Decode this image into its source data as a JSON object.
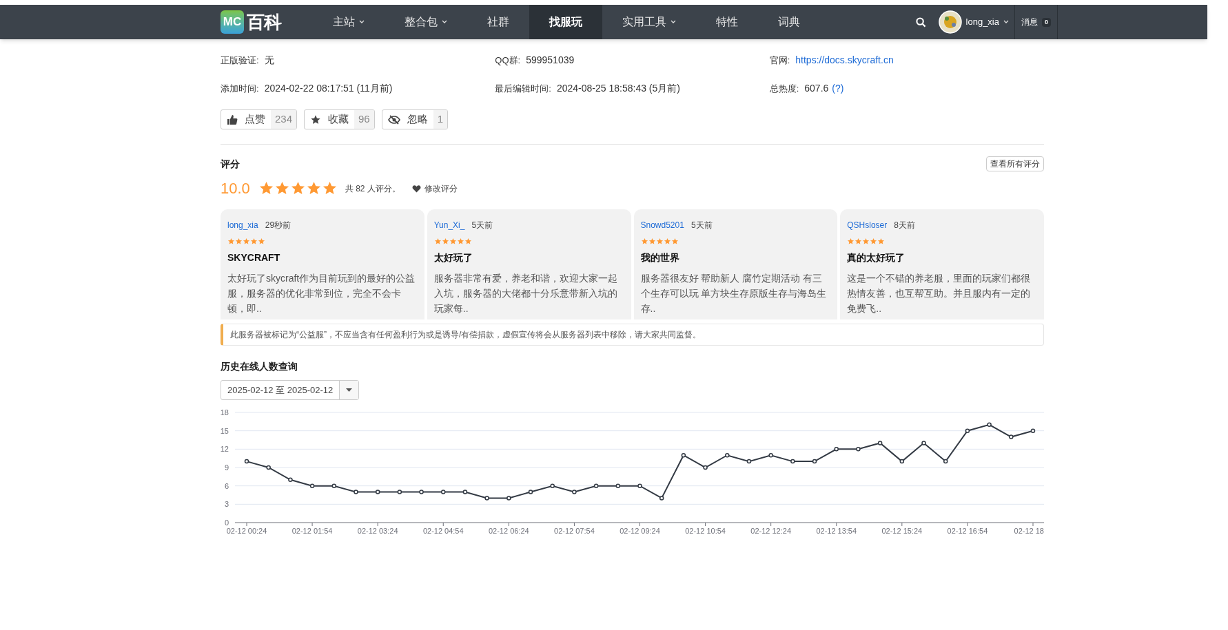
{
  "navbar": {
    "logo_badge": "MC",
    "logo_text": "百科",
    "items": [
      {
        "label": "主站",
        "dropdown": true,
        "selected": false
      },
      {
        "label": "整合包",
        "dropdown": true,
        "selected": false
      },
      {
        "label": "社群",
        "dropdown": false,
        "selected": false
      },
      {
        "label": "找服玩",
        "dropdown": false,
        "selected": true
      },
      {
        "label": "实用工具",
        "dropdown": true,
        "selected": false
      },
      {
        "label": "特性",
        "dropdown": false,
        "selected": false
      },
      {
        "label": "词典",
        "dropdown": false,
        "selected": false
      }
    ],
    "username": "long_xia",
    "messages_label": "消息",
    "messages_count": "0"
  },
  "info": [
    {
      "label": "正版验证:",
      "value": "无",
      "kind": "text"
    },
    {
      "label": "QQ群:",
      "value": "599951039",
      "kind": "text"
    },
    {
      "label": "官网:",
      "value": "https://docs.skycraft.cn",
      "kind": "link"
    },
    {
      "label": "添加时间:",
      "value": "2024-02-22 08:17:51 (11月前)",
      "kind": "text"
    },
    {
      "label": "最后编辑时间:",
      "value": "2024-08-25 18:58:43 (5月前)",
      "kind": "text"
    },
    {
      "label": "总热度:",
      "value": "607.6",
      "kind": "help",
      "help": "(?)"
    }
  ],
  "actions": [
    {
      "kind": "like",
      "label": "点赞",
      "count": "234"
    },
    {
      "kind": "favorite",
      "label": "收藏",
      "count": "96"
    },
    {
      "kind": "ignore",
      "label": "忽略",
      "count": "1"
    }
  ],
  "rating": {
    "title": "评分",
    "view_all": "查看所有评分",
    "score": "10.0",
    "stars": 5,
    "count_text": "共 82 人评分。",
    "edit": "修改评分"
  },
  "reviews": [
    {
      "user": "long_xia",
      "time": "29秒前",
      "stars": 5,
      "title": "SKYCRAFT",
      "body": "太好玩了skycraft作为目前玩到的最好的公益服，服务器的优化非常到位，完全不会卡顿，即.."
    },
    {
      "user": "Yun_Xi_",
      "time": "5天前",
      "stars": 5,
      "title": "太好玩了",
      "body": "服务器非常有爱，养老和谐，欢迎大家一起入坑，服务器的大佬都十分乐意带新入坑的玩家每.."
    },
    {
      "user": "Snowd5201",
      "time": "5天前",
      "stars": 5,
      "title": "我的世界",
      "body": "服务器很友好 帮助新人 腐竹定期活动 有三个生存可以玩 单方块生存原版生存与海岛生存.."
    },
    {
      "user": "QSHsloser",
      "time": "8天前",
      "stars": 5,
      "title": "真的太好玩了",
      "body": "这是一个不错的养老服，里面的玩家们都很热情友善，也互帮互助。并且服内有一定的免费飞.."
    }
  ],
  "notice": "此服务器被标记为“公益服”，不应当含有任何盈利行为或是诱导/有偿捐款，虚假宣传将会从服务器列表中移除，请大家共同监督。",
  "history": {
    "title": "历史在线人数查询",
    "date_range": "2025-02-12 至 2025-02-12",
    "chart_data": {
      "type": "line",
      "categories": [
        "02-12 00:24",
        null,
        null,
        "02-12 01:54",
        null,
        null,
        "02-12 03:24",
        null,
        null,
        "02-12 04:54",
        null,
        null,
        "02-12 06:24",
        null,
        null,
        "02-12 07:54",
        null,
        null,
        "02-12 09:24",
        null,
        null,
        "02-12 10:54",
        null,
        null,
        "02-12 12:24",
        null,
        null,
        "02-12 13:54",
        null,
        null,
        "02-12 15:24",
        null,
        null,
        "02-12 16:54",
        null,
        null,
        "02-12 18"
      ],
      "series": [
        {
          "color": "#333a44",
          "marker": "circle",
          "values": [
            10,
            9,
            7,
            6,
            6,
            5,
            5,
            5,
            5,
            5,
            5,
            4,
            4,
            5,
            6,
            5,
            6,
            6,
            6,
            4,
            11,
            9,
            11,
            10,
            11,
            10,
            10,
            12,
            12,
            13,
            10,
            13,
            10,
            15,
            16,
            14,
            15
          ]
        }
      ],
      "ylim": [
        0,
        18
      ],
      "yticks": [
        0,
        3,
        6,
        9,
        12,
        15,
        18
      ],
      "grid": true
    }
  }
}
